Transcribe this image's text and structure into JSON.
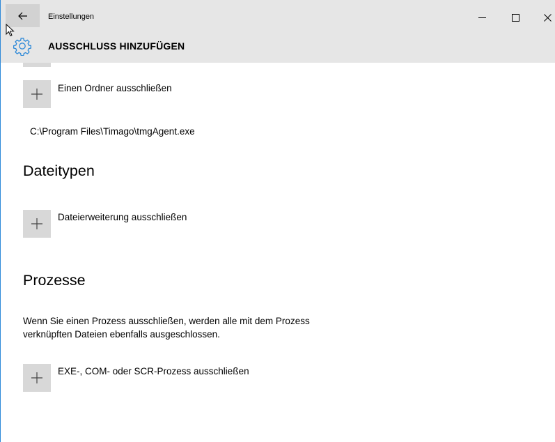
{
  "window": {
    "title": "Einstellungen",
    "accent_color": "#2b88d8"
  },
  "header": {
    "title": "AUSSCHLUSS HINZUFÜGEN",
    "icon": "gear-icon"
  },
  "folders": {
    "add_label": "Einen Ordner ausschließen",
    "excluded_items": [
      "C:\\Program Files\\Timago\\tmgAgent.exe"
    ]
  },
  "filetypes": {
    "heading": "Dateitypen",
    "add_label": "Dateierweiterung ausschließen"
  },
  "processes": {
    "heading": "Prozesse",
    "description": "Wenn Sie einen Prozess ausschließen, werden alle mit dem Prozess verknüpften Dateien ebenfalls ausgeschlossen.",
    "add_label": "EXE-, COM- oder SCR-Prozess ausschließen"
  }
}
